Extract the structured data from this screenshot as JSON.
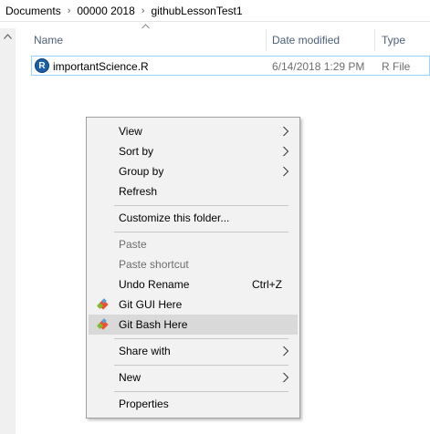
{
  "breadcrumb": [
    {
      "label": "Documents"
    },
    {
      "label": "00000 2018"
    },
    {
      "label": "githubLessonTest1"
    }
  ],
  "columns": {
    "name": "Name",
    "date_modified": "Date modified",
    "type": "Type"
  },
  "file": {
    "icon_letter": "R",
    "name": "importantScience.R",
    "date": "6/14/2018 1:29 PM",
    "type": "R File"
  },
  "context_menu": {
    "view": "View",
    "sort_by": "Sort by",
    "group_by": "Group by",
    "refresh": "Refresh",
    "customize": "Customize this folder...",
    "paste": "Paste",
    "paste_shortcut": "Paste shortcut",
    "undo_rename": "Undo Rename",
    "undo_rename_shortcut": "Ctrl+Z",
    "git_gui": "Git GUI Here",
    "git_bash": "Git Bash Here",
    "share_with": "Share with",
    "new": "New",
    "properties": "Properties"
  },
  "colors": {
    "accent_selection": "#99d1ff",
    "menu_highlight": "#d9d9d9",
    "git_orange": "#f05032"
  },
  "icons": {
    "breadcrumb_separator": "chevron-right-icon",
    "submenu": "chevron-right-icon",
    "git": "git-logo-icon",
    "r_file": "r-file-icon",
    "scroll_up": "caret-up-icon",
    "sort": "sort-ascending-icon"
  }
}
